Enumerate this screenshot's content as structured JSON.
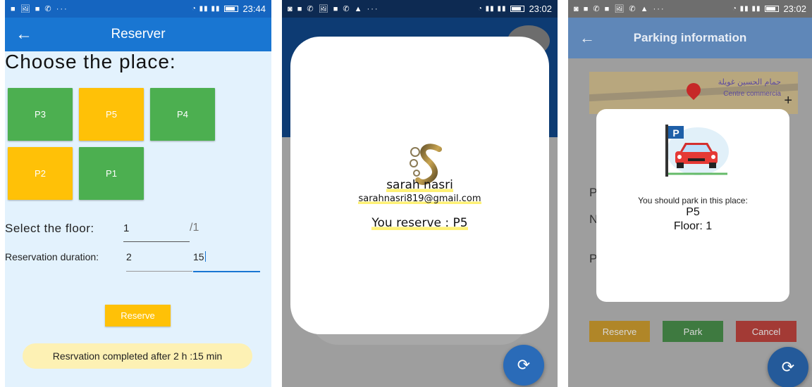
{
  "screen1": {
    "status": {
      "time": "23:44",
      "left_icons": "■ 🖼 ■ ✆ ···"
    },
    "appbar": {
      "back_glyph": "←",
      "title": "Reserver"
    },
    "heading": "Choose the place:",
    "slots": [
      {
        "label": "P3",
        "status_color": "#4caf50"
      },
      {
        "label": "P5",
        "status_color": "#ffc107"
      },
      {
        "label": "P4",
        "status_color": "#4caf50"
      },
      {
        "label": "P2",
        "status_color": "#ffc107"
      },
      {
        "label": "P1",
        "status_color": "#4caf50"
      }
    ],
    "floor": {
      "label": "Select the floor:",
      "value": "1",
      "max": "/1"
    },
    "duration": {
      "label": "Reservation duration:",
      "hours": "2",
      "minutes": "15"
    },
    "reserve_button": "Reserve",
    "toast": "Resrvation completed after 2 h :15 min",
    "colors": {
      "appbar": "#1976d2",
      "available": "#4caf50",
      "reserved": "#ffc107",
      "background": "#e3f2fd"
    }
  },
  "screen2": {
    "status": {
      "time": "23:02",
      "left_icons": "◙ ■ ✆ 🖼 ■ ✆ ▲ ···"
    },
    "user_name": "sarah nasri",
    "user_email": "sarahnasri819@gmail.com",
    "reservation_text": "You reserve : P5",
    "fab_icon": "refresh-icon"
  },
  "screen3": {
    "status": {
      "time": "23:02",
      "left_icons": "◙ ■ ✆ ■ 🖼 ✆ ▲ ···"
    },
    "appbar": {
      "back_glyph": "←",
      "title": "Parking information"
    },
    "map": {
      "label_ar": "حمام الحسين غويلة",
      "label_fr": "Centre commercia"
    },
    "underlay_letters": [
      "P",
      "N",
      "P"
    ],
    "buttons": [
      "Reserve",
      "Park",
      "Cancel"
    ],
    "dialog": {
      "instruction": "You should park in this place:",
      "spot": "P5",
      "floor": "Floor: 1",
      "sign_letter": "P"
    }
  }
}
